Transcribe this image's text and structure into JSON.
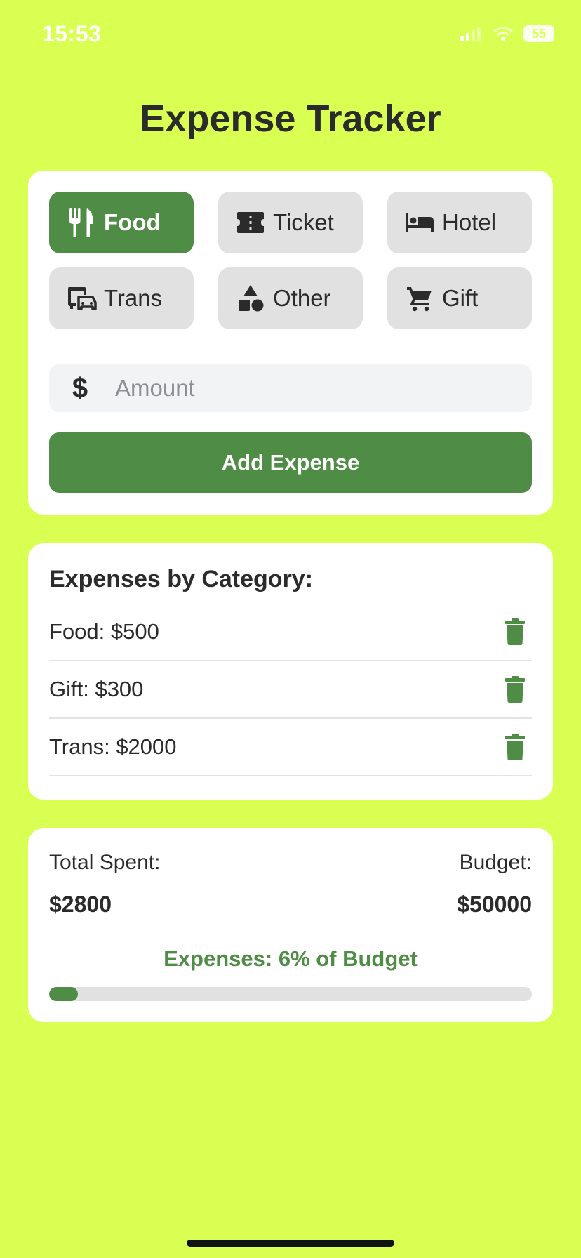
{
  "status_bar": {
    "time": "15:53",
    "battery": "55"
  },
  "app": {
    "title": "Expense Tracker"
  },
  "categories": [
    {
      "label": "Food",
      "icon": "fork-knife-icon",
      "selected": true
    },
    {
      "label": "Ticket",
      "icon": "ticket-icon",
      "selected": false
    },
    {
      "label": "Hotel",
      "icon": "bed-icon",
      "selected": false
    },
    {
      "label": "Trans",
      "icon": "bus-car-icon",
      "selected": false
    },
    {
      "label": "Other",
      "icon": "shapes-icon",
      "selected": false
    },
    {
      "label": "Gift",
      "icon": "cart-icon",
      "selected": false
    }
  ],
  "amount": {
    "placeholder": "Amount",
    "value": "",
    "icon": "dollar-icon"
  },
  "add_button": {
    "label": "Add Expense"
  },
  "expenses": {
    "heading": "Expenses by Category:",
    "items": [
      {
        "text": "Food: $500",
        "icon": "trash-icon"
      },
      {
        "text": "Gift: $300",
        "icon": "trash-icon"
      },
      {
        "text": "Trans: $2000",
        "icon": "trash-icon"
      }
    ]
  },
  "summary": {
    "total_label": "Total Spent:",
    "total_value": "$2800",
    "budget_label": "Budget:",
    "budget_value": "$50000",
    "percent_text": "Expenses: 6% of Budget",
    "progress_percent": 6
  },
  "colors": {
    "background": "#d8ff52",
    "accent": "#4f8c46",
    "card": "#ffffff",
    "chip": "#e1e1e1"
  }
}
